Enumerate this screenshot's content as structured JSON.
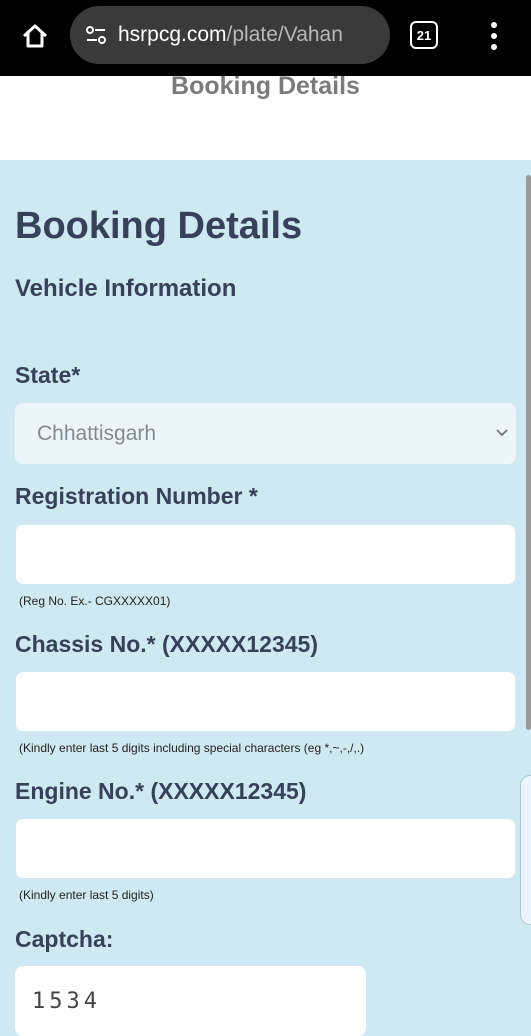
{
  "browser": {
    "url_host": "hsrpcg.com",
    "url_path": "/plate/Vahan",
    "tab_count": "21",
    "icons": [
      "home-icon",
      "site-settings-icon",
      "tabs-icon",
      "more-vert-icon"
    ]
  },
  "page": {
    "header_title": "Booking Details",
    "title": "Booking Details",
    "section": "Vehicle Information"
  },
  "form": {
    "state_label": "State*",
    "state_value": "Chhattisgarh",
    "reg_label": "Registration Number *",
    "reg_value": "",
    "reg_hint": "(Reg No. Ex.- CGXXXXX01)",
    "chassis_label": "Chassis No.* (XXXXX12345)",
    "chassis_value": "",
    "chassis_hint": "(Kindly enter last 5 digits including special characters (eg *,~,-,/,.)",
    "engine_label": "Engine No.* (XXXXX12345)",
    "engine_value": "",
    "engine_hint": "(Kindly enter last 5 digits)",
    "captcha_label": "Captcha:",
    "captcha_value": "1534"
  },
  "colors": {
    "page_bg": "#cfe9f2",
    "heading": "#36415a",
    "browser_bar": "#000000"
  }
}
